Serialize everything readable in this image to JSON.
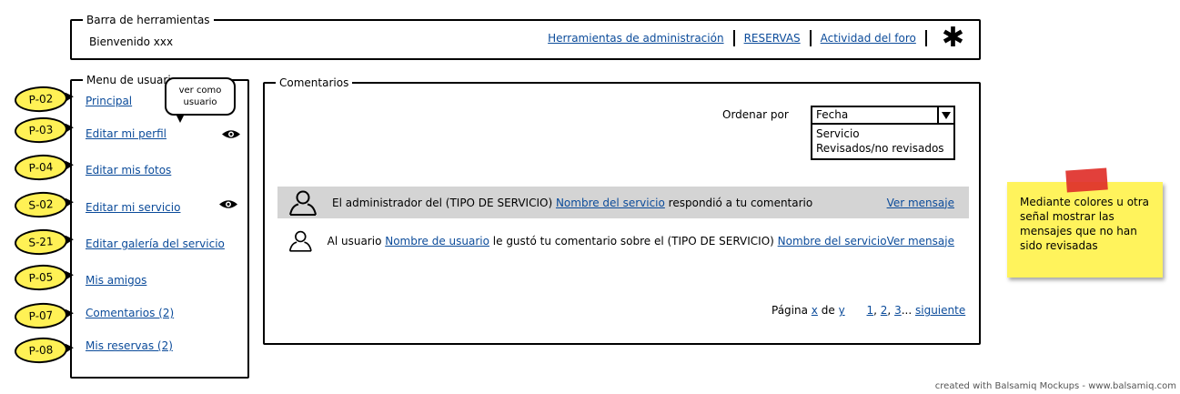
{
  "toolbar": {
    "legend": "Barra de herramientas",
    "welcome": "Bienvenido xxx",
    "links": [
      "Herramientas de administración",
      "RESERVAS",
      "Actividad del foro"
    ],
    "icon": "asterisk-icon"
  },
  "user_menu": {
    "legend": "Menu de usuario",
    "items": [
      {
        "label": "Principal",
        "tag": "P-02"
      },
      {
        "label": "Editar mi perfil",
        "tag": "P-03",
        "icon": "eye-icon"
      },
      {
        "label": "Editar mis fotos",
        "tag": "P-04"
      },
      {
        "label": "Editar mi servicio",
        "tag": "S-02",
        "icon": "eye-icon"
      },
      {
        "label": "Editar galería del servicio",
        "tag": "S-21"
      },
      {
        "label": "Mis amigos",
        "tag": "P-05"
      },
      {
        "label": "Comentarios (2)",
        "tag": "P-07"
      },
      {
        "label": "Mis reservas (2)",
        "tag": "P-08"
      }
    ],
    "callout": "ver como usuario"
  },
  "comments": {
    "legend": "Comentarios",
    "sort_label": "Ordenar por",
    "sort_selected": "Fecha",
    "sort_options": [
      "Servicio",
      "Revisados/no revisados"
    ],
    "rows": [
      {
        "text_before": "El administrador del (TIPO DE SERVICIO) ",
        "link1": "Nombre del servicio",
        "text_after": " respondió a tu comentario",
        "view_link": "Ver mensaje",
        "highlighted": true
      },
      {
        "text_before": "Al usuario ",
        "link1": "Nombre de usuario",
        "text_middle": " le gustó tu comentario sobre el (TIPO DE SERVICIO) ",
        "link2": "Nombre del servicio",
        "view_link": "Ver mensaje",
        "highlighted": false
      }
    ],
    "pagination": {
      "page_label": "Página",
      "x": "x",
      "of": "de",
      "y": "y",
      "pages": [
        "1",
        "2",
        "3"
      ],
      "ellipsis": "...",
      "next": "siguiente"
    }
  },
  "sticky_note": {
    "text": "Mediante colores u otra señal mostrar las mensajes que no han sido revisadas"
  },
  "footer": "created with Balsamiq Mockups - www.balsamiq.com",
  "colors": {
    "link": "#0b4b9a",
    "tag_fill": "#fff155",
    "highlight_row": "#d4d4d4",
    "sticky": "#fff35c",
    "tape": "#e0302a"
  }
}
